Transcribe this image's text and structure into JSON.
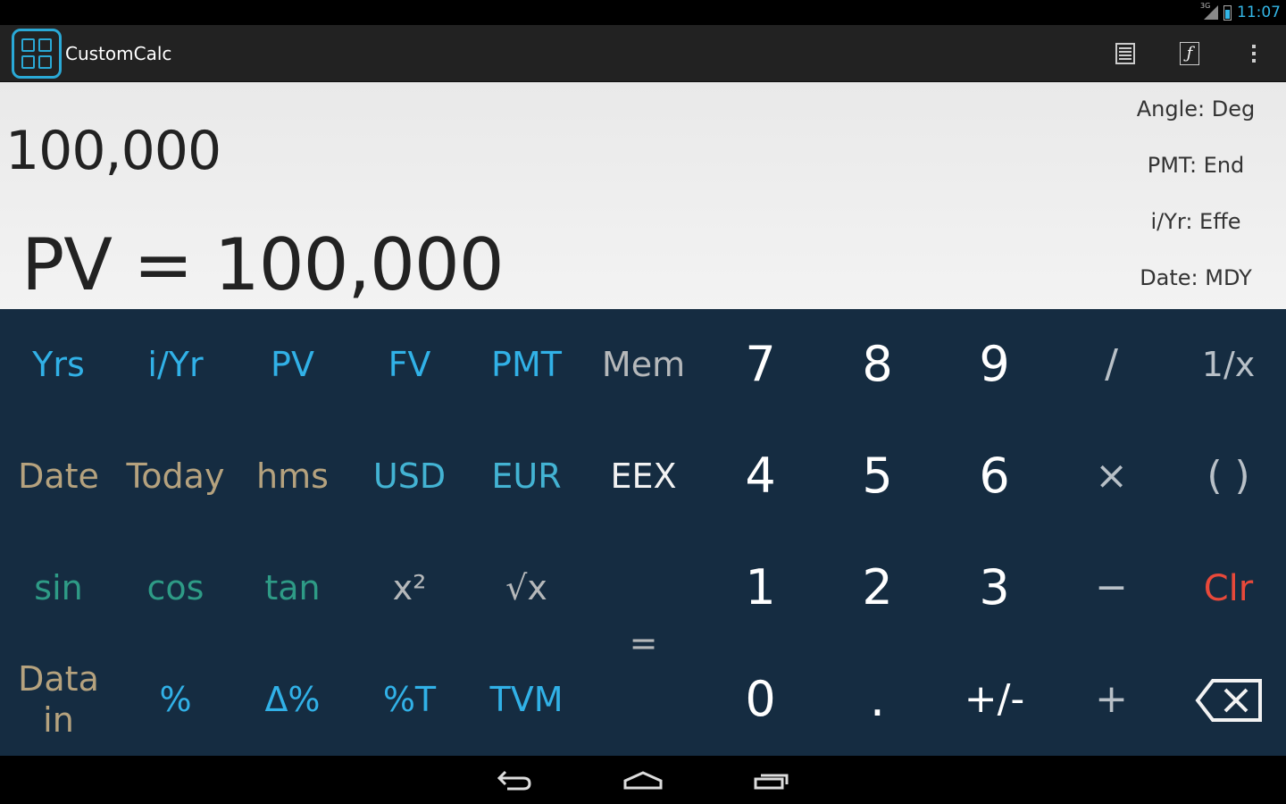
{
  "status_bar": {
    "network": "3G",
    "time": "11:07",
    "accent_color": "#33b5e5"
  },
  "action_bar": {
    "app_title": "CustomCalc",
    "icons": [
      "app-logo-icon",
      "tape-icon",
      "function-icon",
      "overflow-menu-icon"
    ]
  },
  "display": {
    "input": "100,000",
    "result": "PV = 100,000",
    "settings": [
      "Angle: Deg",
      "PMT: End",
      "i/Yr: Effe",
      "Date: MDY"
    ]
  },
  "keypad": {
    "rows": [
      [
        "Yrs",
        "i/Yr",
        "PV",
        "FV",
        "PMT",
        "Mem",
        "7",
        "8",
        "9",
        "/",
        "1/x"
      ],
      [
        "Date",
        "Today",
        "hms",
        "USD",
        "EUR",
        "EEX",
        "4",
        "5",
        "6",
        "×",
        "( )"
      ],
      [
        "sin",
        "cos",
        "tan",
        "x²",
        "√x",
        "1",
        "2",
        "3",
        "−",
        "Clr"
      ],
      [
        "Data in",
        "%",
        "Δ%",
        "%T",
        "TVM",
        "0",
        ".",
        "+/-",
        "+"
      ]
    ],
    "equals": "=",
    "backspace_icon": "backspace-icon",
    "colors": {
      "background": "#152c41",
      "financial": "#31b1e7",
      "memory": "#b5b8ba",
      "date": "#b5a27e",
      "currency": "#43b3d3",
      "trig": "#2e9b86",
      "number": "#ffffff",
      "clear": "#e8493a"
    }
  },
  "nav_bar": {
    "icons": [
      "back-icon",
      "home-icon",
      "recent-apps-icon"
    ]
  }
}
